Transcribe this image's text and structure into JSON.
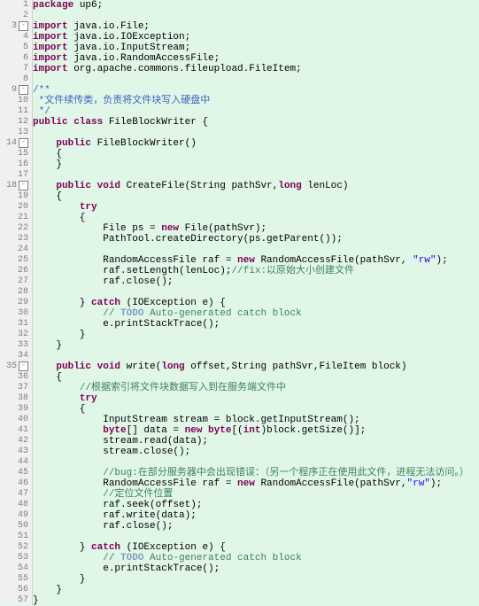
{
  "lines": [
    {
      "n": "1",
      "f": "",
      "t": [
        [
          "kw",
          "package"
        ],
        [
          "",
          " up6;"
        ]
      ]
    },
    {
      "n": "2",
      "f": "",
      "t": [
        [
          "",
          ""
        ]
      ]
    },
    {
      "n": "3",
      "f": "-",
      "t": [
        [
          "kw",
          "import"
        ],
        [
          "",
          " java.io.File;"
        ]
      ]
    },
    {
      "n": "4",
      "f": "",
      "t": [
        [
          "kw",
          "import"
        ],
        [
          "",
          " java.io.IOException;"
        ]
      ]
    },
    {
      "n": "5",
      "f": "",
      "t": [
        [
          "kw",
          "import"
        ],
        [
          "",
          " java.io.InputStream;"
        ]
      ]
    },
    {
      "n": "6",
      "f": "",
      "t": [
        [
          "kw",
          "import"
        ],
        [
          "",
          " java.io.RandomAccessFile;"
        ]
      ]
    },
    {
      "n": "7",
      "f": "",
      "t": [
        [
          "kw",
          "import"
        ],
        [
          "",
          " org.apache.commons.fileupload.FileItem;"
        ]
      ]
    },
    {
      "n": "8",
      "f": "",
      "t": [
        [
          "",
          ""
        ]
      ]
    },
    {
      "n": "9",
      "f": "-",
      "t": [
        [
          "doc",
          "/**"
        ]
      ]
    },
    {
      "n": "10",
      "f": "",
      "t": [
        [
          "doc",
          " *"
        ],
        [
          "cn",
          "文件续传类，负责将文件块写入硬盘中"
        ]
      ]
    },
    {
      "n": "11",
      "f": "",
      "t": [
        [
          "doc",
          " */"
        ]
      ]
    },
    {
      "n": "12",
      "f": "",
      "t": [
        [
          "kw",
          "public class"
        ],
        [
          "",
          " FileBlockWriter {"
        ]
      ]
    },
    {
      "n": "13",
      "f": "",
      "t": [
        [
          "",
          ""
        ]
      ]
    },
    {
      "n": "14",
      "f": "-",
      "t": [
        [
          "",
          "    "
        ],
        [
          "kw",
          "public"
        ],
        [
          "",
          " FileBlockWriter()"
        ]
      ]
    },
    {
      "n": "15",
      "f": "",
      "t": [
        [
          "",
          "    {"
        ]
      ]
    },
    {
      "n": "16",
      "f": "",
      "t": [
        [
          "",
          "    }"
        ]
      ]
    },
    {
      "n": "17",
      "f": "",
      "t": [
        [
          "",
          ""
        ]
      ]
    },
    {
      "n": "18",
      "f": "-",
      "t": [
        [
          "",
          "    "
        ],
        [
          "kw",
          "public void"
        ],
        [
          "",
          " CreateFile(String pathSvr,"
        ],
        [
          "kw",
          "long"
        ],
        [
          "",
          " lenLoc)"
        ]
      ]
    },
    {
      "n": "19",
      "f": "",
      "t": [
        [
          "",
          "    {"
        ]
      ]
    },
    {
      "n": "20",
      "f": "",
      "t": [
        [
          "",
          "        "
        ],
        [
          "kw",
          "try"
        ]
      ]
    },
    {
      "n": "21",
      "f": "",
      "t": [
        [
          "",
          "        {"
        ]
      ]
    },
    {
      "n": "22",
      "f": "",
      "t": [
        [
          "",
          "            File ps = "
        ],
        [
          "kw",
          "new"
        ],
        [
          "",
          " File(pathSvr);"
        ]
      ]
    },
    {
      "n": "23",
      "f": "",
      "t": [
        [
          "",
          "            PathTool.createDirectory(ps.getParent());"
        ]
      ]
    },
    {
      "n": "24",
      "f": "",
      "t": [
        [
          "",
          ""
        ]
      ]
    },
    {
      "n": "25",
      "f": "",
      "t": [
        [
          "",
          "            RandomAccessFile raf = "
        ],
        [
          "kw",
          "new"
        ],
        [
          "",
          " RandomAccessFile(pathSvr, "
        ],
        [
          "str",
          "\"rw\""
        ],
        [
          "",
          ");"
        ]
      ]
    },
    {
      "n": "26",
      "f": "",
      "t": [
        [
          "",
          "            raf.setLength(lenLoc);"
        ],
        [
          "com",
          "//fix:以原始大小创建文件"
        ]
      ]
    },
    {
      "n": "27",
      "f": "",
      "t": [
        [
          "",
          "            raf.close();"
        ]
      ]
    },
    {
      "n": "28",
      "f": "",
      "t": [
        [
          "",
          ""
        ]
      ]
    },
    {
      "n": "29",
      "f": "",
      "t": [
        [
          "",
          "        } "
        ],
        [
          "kw",
          "catch"
        ],
        [
          "",
          " (IOException e) {"
        ]
      ]
    },
    {
      "n": "30",
      "f": "",
      "t": [
        [
          "",
          "            "
        ],
        [
          "com",
          "// "
        ],
        [
          "todo",
          "TODO"
        ],
        [
          "com",
          " Auto-generated catch block"
        ]
      ]
    },
    {
      "n": "31",
      "f": "",
      "t": [
        [
          "",
          "            e.printStackTrace();"
        ]
      ]
    },
    {
      "n": "32",
      "f": "",
      "t": [
        [
          "",
          "        }"
        ]
      ]
    },
    {
      "n": "33",
      "f": "",
      "t": [
        [
          "",
          "    }"
        ]
      ]
    },
    {
      "n": "34",
      "f": "",
      "t": [
        [
          "",
          ""
        ]
      ]
    },
    {
      "n": "35",
      "f": "-",
      "t": [
        [
          "",
          "    "
        ],
        [
          "kw",
          "public void"
        ],
        [
          "",
          " write("
        ],
        [
          "kw",
          "long"
        ],
        [
          "",
          " offset,String pathSvr,FileItem block)"
        ]
      ]
    },
    {
      "n": "36",
      "f": "",
      "t": [
        [
          "",
          "    {"
        ]
      ]
    },
    {
      "n": "37",
      "f": "",
      "t": [
        [
          "",
          "        "
        ],
        [
          "com",
          "//根据索引将文件块数据写入到在服务端文件中"
        ]
      ]
    },
    {
      "n": "38",
      "f": "",
      "t": [
        [
          "",
          "        "
        ],
        [
          "kw",
          "try"
        ]
      ]
    },
    {
      "n": "39",
      "f": "",
      "t": [
        [
          "",
          "        {"
        ]
      ]
    },
    {
      "n": "40",
      "f": "",
      "t": [
        [
          "",
          "            InputStream stream = block.getInputStream();"
        ]
      ]
    },
    {
      "n": "41",
      "f": "",
      "t": [
        [
          "",
          "            "
        ],
        [
          "kw",
          "byte"
        ],
        [
          "",
          "[] data = "
        ],
        [
          "kw",
          "new byte"
        ],
        [
          "",
          "[("
        ],
        [
          "kw",
          "int"
        ],
        [
          "",
          ")block.getSize()];"
        ]
      ]
    },
    {
      "n": "42",
      "f": "",
      "t": [
        [
          "",
          "            stream.read(data);"
        ]
      ]
    },
    {
      "n": "43",
      "f": "",
      "t": [
        [
          "",
          "            stream.close();"
        ]
      ]
    },
    {
      "n": "44",
      "f": "",
      "t": [
        [
          "",
          ""
        ]
      ]
    },
    {
      "n": "45",
      "f": "",
      "t": [
        [
          "",
          "            "
        ],
        [
          "com",
          "//bug:在部分服务器中会出现错误：（另一个程序正在使用此文件，进程无法访问。）"
        ]
      ]
    },
    {
      "n": "46",
      "f": "",
      "t": [
        [
          "",
          "            RandomAccessFile raf = "
        ],
        [
          "kw",
          "new"
        ],
        [
          "",
          " RandomAccessFile(pathSvr,"
        ],
        [
          "str",
          "\"rw\""
        ],
        [
          "",
          ");"
        ]
      ]
    },
    {
      "n": "47",
      "f": "",
      "t": [
        [
          "",
          "            "
        ],
        [
          "com",
          "//定位文件位置"
        ]
      ]
    },
    {
      "n": "48",
      "f": "",
      "t": [
        [
          "",
          "            raf.seek(offset);"
        ]
      ]
    },
    {
      "n": "49",
      "f": "",
      "t": [
        [
          "",
          "            raf.write(data);"
        ]
      ]
    },
    {
      "n": "50",
      "f": "",
      "t": [
        [
          "",
          "            raf.close();"
        ]
      ]
    },
    {
      "n": "51",
      "f": "",
      "t": [
        [
          "",
          ""
        ]
      ]
    },
    {
      "n": "52",
      "f": "",
      "t": [
        [
          "",
          "        } "
        ],
        [
          "kw",
          "catch"
        ],
        [
          "",
          " (IOException e) {"
        ]
      ]
    },
    {
      "n": "53",
      "f": "",
      "t": [
        [
          "",
          "            "
        ],
        [
          "com",
          "// "
        ],
        [
          "todo",
          "TODO"
        ],
        [
          "com",
          " Auto-generated catch block"
        ]
      ]
    },
    {
      "n": "54",
      "f": "",
      "t": [
        [
          "",
          "            e.printStackTrace();"
        ]
      ]
    },
    {
      "n": "55",
      "f": "",
      "t": [
        [
          "",
          "        }"
        ]
      ]
    },
    {
      "n": "56",
      "f": "",
      "t": [
        [
          "",
          "    }"
        ]
      ]
    },
    {
      "n": "57",
      "f": "",
      "t": [
        [
          "",
          "}"
        ]
      ]
    }
  ]
}
